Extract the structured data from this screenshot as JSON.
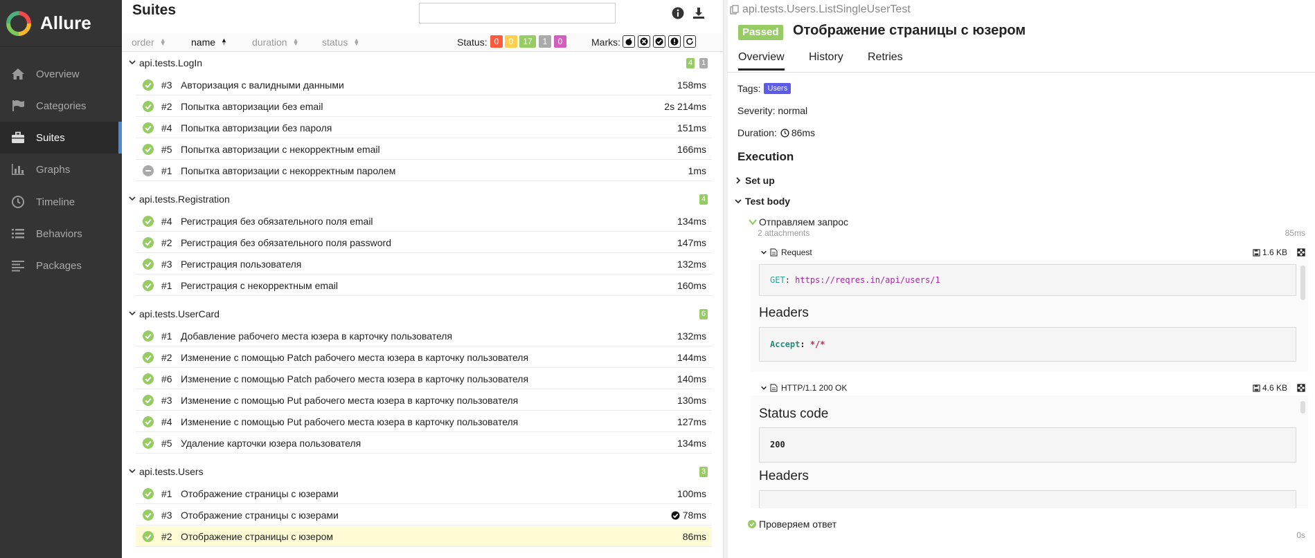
{
  "sidebar": {
    "brand": "Allure",
    "items": [
      {
        "label": "Overview",
        "icon": "home-icon"
      },
      {
        "label": "Categories",
        "icon": "flag-icon"
      },
      {
        "label": "Suites",
        "icon": "briefcase-icon",
        "active": true
      },
      {
        "label": "Graphs",
        "icon": "bar-chart-icon"
      },
      {
        "label": "Timeline",
        "icon": "clock-icon"
      },
      {
        "label": "Behaviors",
        "icon": "list-icon"
      },
      {
        "label": "Packages",
        "icon": "align-left-icon"
      }
    ]
  },
  "suites_panel": {
    "title": "Suites",
    "search": {
      "value": "",
      "placeholder": ""
    },
    "sort": {
      "order": "order",
      "name": "name",
      "duration": "duration",
      "status": "status"
    },
    "status_label": "Status:",
    "status_counts": {
      "failed": "0",
      "broken": "0",
      "passed": "17",
      "skipped": "1",
      "unknown": "0"
    },
    "marks_label": "Marks:",
    "colors": {
      "failed": "#fd5a3e",
      "broken": "#ffd050",
      "passed": "#97cc64",
      "skipped": "#aaaaaa",
      "unknown": "#d35ebe"
    },
    "groups": [
      {
        "name": "api.tests.LogIn",
        "badges": {
          "passed": "4",
          "skipped": "1"
        },
        "rows": [
          {
            "num": "#3",
            "name": "Авторизация с валидными данными",
            "duration": "158ms",
            "status": "passed"
          },
          {
            "num": "#2",
            "name": "Попытка авторизации без email",
            "duration": "2s 214ms",
            "status": "passed"
          },
          {
            "num": "#4",
            "name": "Попытка авторизации без пароля",
            "duration": "151ms",
            "status": "passed"
          },
          {
            "num": "#5",
            "name": "Попытка авторизации с некорректным email",
            "duration": "166ms",
            "status": "passed"
          },
          {
            "num": "#1",
            "name": "Попытка авторизации с некорректным паролем",
            "duration": "1ms",
            "status": "skipped"
          }
        ]
      },
      {
        "name": "api.tests.Registration",
        "badges": {
          "passed": "4"
        },
        "rows": [
          {
            "num": "#4",
            "name": "Регистрация без обязательного поля email",
            "duration": "134ms",
            "status": "passed"
          },
          {
            "num": "#2",
            "name": "Регистрация без обязательного поля password",
            "duration": "147ms",
            "status": "passed"
          },
          {
            "num": "#3",
            "name": "Регистрация пользователя",
            "duration": "132ms",
            "status": "passed"
          },
          {
            "num": "#1",
            "name": "Регистрация с некорректным email",
            "duration": "160ms",
            "status": "passed"
          }
        ]
      },
      {
        "name": "api.tests.UserCard",
        "badges": {
          "passed": "6"
        },
        "rows": [
          {
            "num": "#1",
            "name": "Добавление рабочего места юзера в карточку пользователя",
            "duration": "132ms",
            "status": "passed"
          },
          {
            "num": "#2",
            "name": "Изменение с помощью Patch рабочего места юзера в карточку пользователя",
            "duration": "144ms",
            "status": "passed"
          },
          {
            "num": "#6",
            "name": "Изменение с помощью Patch рабочего места юзера в карточку пользователя",
            "duration": "140ms",
            "status": "passed"
          },
          {
            "num": "#3",
            "name": "Изменение с помощью Put рабочего места юзера в карточку пользователя",
            "duration": "130ms",
            "status": "passed"
          },
          {
            "num": "#4",
            "name": "Изменение с помощью Put рабочего места юзера в карточку пользователя",
            "duration": "127ms",
            "status": "passed"
          },
          {
            "num": "#5",
            "name": "Удаление карточки юзера пользователя",
            "duration": "134ms",
            "status": "passed"
          }
        ]
      },
      {
        "name": "api.tests.Users",
        "badges": {
          "passed": "3"
        },
        "rows": [
          {
            "num": "#1",
            "name": "Отображение страницы с юзерами",
            "duration": "100ms",
            "status": "passed"
          },
          {
            "num": "#3",
            "name": "Отображение страницы с юзерами",
            "duration": "78ms",
            "status": "passed",
            "flaky": true
          },
          {
            "num": "#2",
            "name": "Отображение страницы с юзером",
            "duration": "86ms",
            "status": "passed",
            "selected": true
          }
        ]
      }
    ]
  },
  "detail": {
    "breadcrumb": "api.tests.Users.ListSingleUserTest",
    "status_badge": "Passed",
    "title": "Отображение страницы с юзером",
    "tabs": [
      "Overview",
      "History",
      "Retries"
    ],
    "tags_label": "Tags:",
    "tag": "Users",
    "severity": "Severity: normal",
    "duration_label": "Duration:",
    "duration": "86ms",
    "execution_title": "Execution",
    "setup_label": "Set up",
    "test_body_label": "Test body",
    "step1": {
      "name": "Отправляем запрос",
      "attachments": "2 attachments",
      "duration": "85ms"
    },
    "request": {
      "name": "Request",
      "size": "1.6 KB",
      "method": "GET",
      "colon": ": ",
      "url": "https://reqres.in/api/users/1",
      "headers_title": "Headers",
      "header_key": "Accept",
      "header_sep": ": ",
      "header_value": "*/*"
    },
    "response": {
      "name": "HTTP/1.1 200 OK",
      "size": "4.6 KB",
      "status_code_title": "Status code",
      "status_code": "200",
      "headers_title": "Headers"
    },
    "step2": {
      "name": "Проверяем ответ",
      "duration": "0s"
    }
  }
}
